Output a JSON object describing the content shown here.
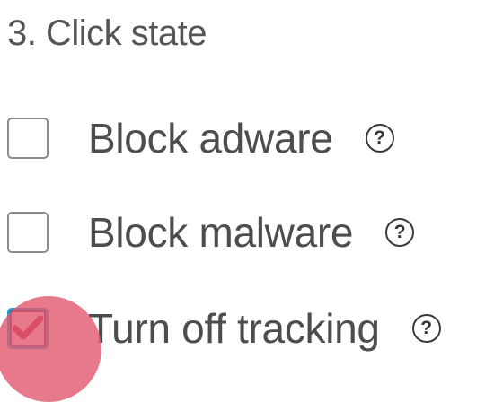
{
  "section": {
    "title": "3. Click state"
  },
  "options": [
    {
      "label": "Block adware",
      "checked": false,
      "help_icon": "question-circle-icon",
      "help_text": "?"
    },
    {
      "label": "Block malware",
      "checked": false,
      "help_icon": "question-circle-icon",
      "help_text": "?"
    },
    {
      "label": "Turn off tracking",
      "checked": true,
      "help_icon": "question-circle-icon",
      "help_text": "?"
    }
  ],
  "colors": {
    "checkbox_focus_border": "#1a9fd6",
    "checkbox_inner_border": "#6b2f6f",
    "checkmark": "#b3122e",
    "click_indicator": "#e25c70",
    "text": "#4d4d4d"
  },
  "icons": {
    "checkmark": "check-icon",
    "help": "question-circle-icon"
  }
}
